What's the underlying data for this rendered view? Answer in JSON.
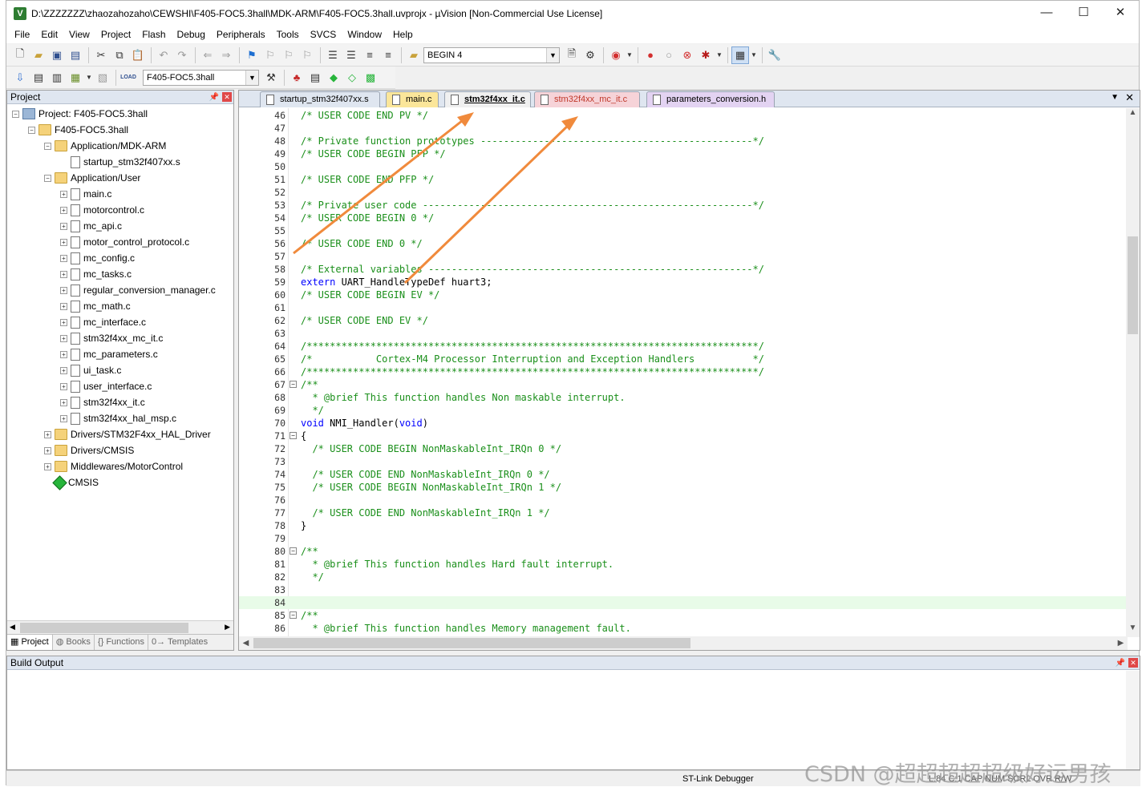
{
  "title_bar": {
    "app_icon": "keil-v-icon",
    "title": "D:\\ZZZZZZZ\\zhaozahozaho\\CEWSHI\\F405-FOC5.3hall\\MDK-ARM\\F405-FOC5.3hall.uvprojx - µVision  [Non-Commercial Use License]",
    "minimize": "—",
    "maximize": "☐",
    "close": "✕"
  },
  "menu": [
    "File",
    "Edit",
    "View",
    "Project",
    "Flash",
    "Debug",
    "Peripherals",
    "Tools",
    "SVCS",
    "Window",
    "Help"
  ],
  "toolbar1": {
    "find_combo_value": "BEGIN 4"
  },
  "toolbar2": {
    "target_combo_value": "F405-FOC5.3hall",
    "load_label": "LOAD"
  },
  "project_panel": {
    "title": "Project",
    "tree": [
      {
        "label": "Project: F405-FOC5.3hall",
        "level": 0,
        "icon": "project-icon",
        "expander": "−"
      },
      {
        "label": "F405-FOC5.3hall",
        "level": 1,
        "icon": "folder-icon",
        "expander": "−"
      },
      {
        "label": "Application/MDK-ARM",
        "level": 2,
        "icon": "folder-icon",
        "expander": "−"
      },
      {
        "label": "startup_stm32f407xx.s",
        "level": 3,
        "icon": "file-icon",
        "expander": ""
      },
      {
        "label": "Application/User",
        "level": 2,
        "icon": "folder-icon",
        "expander": "−"
      },
      {
        "label": "main.c",
        "level": 3,
        "icon": "file-icon",
        "expander": "+"
      },
      {
        "label": "motorcontrol.c",
        "level": 3,
        "icon": "file-icon",
        "expander": "+"
      },
      {
        "label": "mc_api.c",
        "level": 3,
        "icon": "file-icon",
        "expander": "+"
      },
      {
        "label": "motor_control_protocol.c",
        "level": 3,
        "icon": "file-icon",
        "expander": "+"
      },
      {
        "label": "mc_config.c",
        "level": 3,
        "icon": "file-icon",
        "expander": "+"
      },
      {
        "label": "mc_tasks.c",
        "level": 3,
        "icon": "file-icon",
        "expander": "+"
      },
      {
        "label": "regular_conversion_manager.c",
        "level": 3,
        "icon": "file-icon",
        "expander": "+"
      },
      {
        "label": "mc_math.c",
        "level": 3,
        "icon": "file-icon",
        "expander": "+"
      },
      {
        "label": "mc_interface.c",
        "level": 3,
        "icon": "file-icon",
        "expander": "+"
      },
      {
        "label": "stm32f4xx_mc_it.c",
        "level": 3,
        "icon": "file-icon",
        "expander": "+"
      },
      {
        "label": "mc_parameters.c",
        "level": 3,
        "icon": "file-icon",
        "expander": "+"
      },
      {
        "label": "ui_task.c",
        "level": 3,
        "icon": "file-icon",
        "expander": "+"
      },
      {
        "label": "user_interface.c",
        "level": 3,
        "icon": "file-icon",
        "expander": "+"
      },
      {
        "label": "stm32f4xx_it.c",
        "level": 3,
        "icon": "file-icon",
        "expander": "+"
      },
      {
        "label": "stm32f4xx_hal_msp.c",
        "level": 3,
        "icon": "file-icon",
        "expander": "+"
      },
      {
        "label": "Drivers/STM32F4xx_HAL_Driver",
        "level": 2,
        "icon": "folder-icon",
        "expander": "+"
      },
      {
        "label": "Drivers/CMSIS",
        "level": 2,
        "icon": "folder-icon",
        "expander": "+"
      },
      {
        "label": "Middlewares/MotorControl",
        "level": 2,
        "icon": "folder-icon",
        "expander": "+"
      },
      {
        "label": "CMSIS",
        "level": 2,
        "icon": "gem-icon",
        "expander": ""
      }
    ],
    "bottom_tabs": [
      "Project",
      "Books",
      "{} Functions",
      "0→ Templates"
    ]
  },
  "editor": {
    "tabs": [
      {
        "label": "startup_stm32f407xx.s",
        "color": "#dfe6f0",
        "text_color": "#000000",
        "active": false
      },
      {
        "label": "main.c",
        "color": "#fbe69a",
        "text_color": "#000000",
        "active": false
      },
      {
        "label": "stm32f4xx_it.c",
        "color": "#f0f0f0",
        "text_color": "#000000",
        "active": true
      },
      {
        "label": "stm32f4xx_mc_it.c",
        "color": "#f6d3d8",
        "text_color": "#c0392b",
        "active": false
      },
      {
        "label": "parameters_conversion.h",
        "color": "#e3d3f2",
        "text_color": "#000000",
        "active": false
      }
    ],
    "lines": [
      {
        "n": "46",
        "fold": "",
        "parts": [
          {
            "c": "com",
            "t": "/* USER CODE END PV */"
          }
        ]
      },
      {
        "n": "47",
        "fold": "",
        "parts": []
      },
      {
        "n": "48",
        "fold": "",
        "parts": [
          {
            "c": "com",
            "t": "/* Private function prototypes -----------------------------------------------*/"
          }
        ]
      },
      {
        "n": "49",
        "fold": "",
        "parts": [
          {
            "c": "com",
            "t": "/* USER CODE BEGIN PFP */"
          }
        ]
      },
      {
        "n": "50",
        "fold": "",
        "parts": []
      },
      {
        "n": "51",
        "fold": "",
        "parts": [
          {
            "c": "com",
            "t": "/* USER CODE END PFP */"
          }
        ]
      },
      {
        "n": "52",
        "fold": "",
        "parts": []
      },
      {
        "n": "53",
        "fold": "",
        "parts": [
          {
            "c": "com",
            "t": "/* Private user code ---------------------------------------------------------*/"
          }
        ]
      },
      {
        "n": "54",
        "fold": "",
        "parts": [
          {
            "c": "com",
            "t": "/* USER CODE BEGIN 0 */"
          }
        ]
      },
      {
        "n": "55",
        "fold": "",
        "parts": []
      },
      {
        "n": "56",
        "fold": "",
        "parts": [
          {
            "c": "com",
            "t": "/* USER CODE END 0 */"
          }
        ]
      },
      {
        "n": "57",
        "fold": "",
        "parts": []
      },
      {
        "n": "58",
        "fold": "",
        "parts": [
          {
            "c": "com",
            "t": "/* External variables --------------------------------------------------------*/"
          }
        ]
      },
      {
        "n": "59",
        "fold": "",
        "parts": [
          {
            "c": "kw",
            "t": "extern"
          },
          {
            "c": "txt",
            "t": " UART_HandleTypeDef huart3;"
          }
        ]
      },
      {
        "n": "60",
        "fold": "",
        "parts": [
          {
            "c": "com",
            "t": "/* USER CODE BEGIN EV */"
          }
        ]
      },
      {
        "n": "61",
        "fold": "",
        "parts": []
      },
      {
        "n": "62",
        "fold": "",
        "parts": [
          {
            "c": "com",
            "t": "/* USER CODE END EV */"
          }
        ]
      },
      {
        "n": "63",
        "fold": "",
        "parts": []
      },
      {
        "n": "64",
        "fold": "",
        "parts": [
          {
            "c": "com",
            "t": "/******************************************************************************/"
          }
        ]
      },
      {
        "n": "65",
        "fold": "",
        "parts": [
          {
            "c": "com",
            "t": "/*           Cortex-M4 Processor Interruption and Exception Handlers          */"
          }
        ]
      },
      {
        "n": "66",
        "fold": "",
        "parts": [
          {
            "c": "com",
            "t": "/******************************************************************************/"
          }
        ]
      },
      {
        "n": "67",
        "fold": "−",
        "parts": [
          {
            "c": "com",
            "t": "/**"
          }
        ]
      },
      {
        "n": "68",
        "fold": "",
        "parts": [
          {
            "c": "com",
            "t": "  * @brief This function handles Non maskable interrupt."
          }
        ]
      },
      {
        "n": "69",
        "fold": "",
        "parts": [
          {
            "c": "com",
            "t": "  */"
          }
        ]
      },
      {
        "n": "70",
        "fold": "",
        "parts": [
          {
            "c": "kw",
            "t": "void"
          },
          {
            "c": "txt",
            "t": " NMI_Handler("
          },
          {
            "c": "kw",
            "t": "void"
          },
          {
            "c": "txt",
            "t": ")"
          }
        ]
      },
      {
        "n": "71",
        "fold": "−",
        "parts": [
          {
            "c": "txt",
            "t": "{"
          }
        ]
      },
      {
        "n": "72",
        "fold": "",
        "parts": [
          {
            "c": "com",
            "t": "  /* USER CODE BEGIN NonMaskableInt_IRQn 0 */"
          }
        ]
      },
      {
        "n": "73",
        "fold": "",
        "parts": []
      },
      {
        "n": "74",
        "fold": "",
        "parts": [
          {
            "c": "com",
            "t": "  /* USER CODE END NonMaskableInt_IRQn 0 */"
          }
        ]
      },
      {
        "n": "75",
        "fold": "",
        "parts": [
          {
            "c": "com",
            "t": "  /* USER CODE BEGIN NonMaskableInt_IRQn 1 */"
          }
        ]
      },
      {
        "n": "76",
        "fold": "",
        "parts": []
      },
      {
        "n": "77",
        "fold": "",
        "parts": [
          {
            "c": "com",
            "t": "  /* USER CODE END NonMaskableInt_IRQn 1 */"
          }
        ]
      },
      {
        "n": "78",
        "fold": "",
        "parts": [
          {
            "c": "txt",
            "t": "}"
          }
        ]
      },
      {
        "n": "79",
        "fold": "",
        "parts": []
      },
      {
        "n": "80",
        "fold": "−",
        "parts": [
          {
            "c": "com",
            "t": "/**"
          }
        ]
      },
      {
        "n": "81",
        "fold": "",
        "parts": [
          {
            "c": "com",
            "t": "  * @brief This function handles Hard fault interrupt."
          }
        ]
      },
      {
        "n": "82",
        "fold": "",
        "parts": [
          {
            "c": "com",
            "t": "  */"
          }
        ]
      },
      {
        "n": "83",
        "fold": "",
        "parts": []
      },
      {
        "n": "84",
        "fold": "",
        "parts": [],
        "highlight": true
      },
      {
        "n": "85",
        "fold": "−",
        "parts": [
          {
            "c": "com",
            "t": "/**"
          }
        ]
      },
      {
        "n": "86",
        "fold": "",
        "parts": [
          {
            "c": "com",
            "t": "  * @brief This function handles Memory management fault."
          }
        ]
      }
    ]
  },
  "build_output": {
    "title": "Build Output"
  },
  "status_bar": {
    "debugger": "ST-Link Debugger",
    "right_text": "L:84 C:1    CAP  NUM  SCRL  OVR  R/W"
  },
  "annotation": {
    "arrow_color": "#f08a3c"
  },
  "watermark": "CSDN @超超超超超级好运男孩"
}
